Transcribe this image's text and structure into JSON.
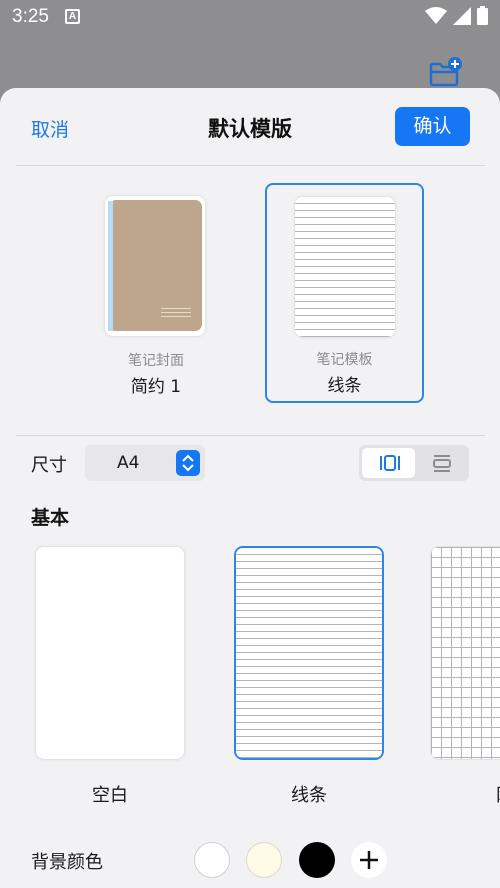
{
  "status_bar": {
    "time": "3:25",
    "notification_badge": "A",
    "icons": [
      "wifi-icon",
      "signal-icon",
      "battery-icon"
    ]
  },
  "top_action_icon": "folder-add-icon",
  "dialog": {
    "cancel_label": "取消",
    "title": "默认模版",
    "confirm_label": "确认"
  },
  "cover_option": {
    "caption": "笔记封面",
    "name": "简约 1"
  },
  "template_option": {
    "caption": "笔记模板",
    "name": "线条"
  },
  "size": {
    "label": "尺寸",
    "value": "A4",
    "orientation_selected": "portrait"
  },
  "basic_section": {
    "title": "基本",
    "papers": [
      {
        "label": "空白",
        "style": "blank",
        "selected": false
      },
      {
        "label": "线条",
        "style": "lined",
        "selected": true
      },
      {
        "label": "网",
        "style": "grid",
        "selected": false
      }
    ]
  },
  "background_color": {
    "label": "背景颜色",
    "swatches": [
      "#ffffff",
      "#fdfbe6",
      "#000000"
    ],
    "add_icon": "plus-icon"
  },
  "colors": {
    "accent": "#1577f3",
    "selection_border": "#2c86e6",
    "cover_brown": "#bda68c",
    "cover_spine": "#b6dbf2"
  }
}
